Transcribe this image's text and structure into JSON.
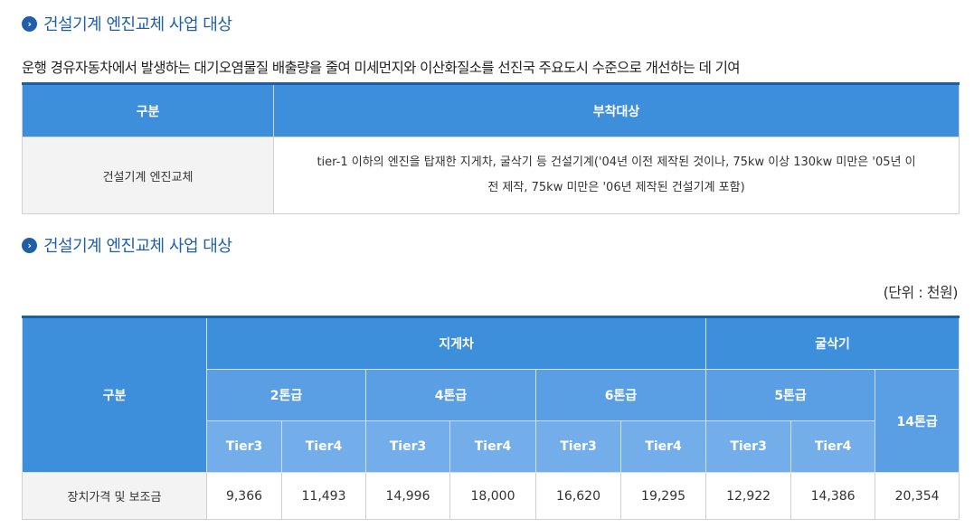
{
  "section1": {
    "heading": "건설기계 엔진교체 사업 대상",
    "description": "운행 경유자동차에서 발생하는 대기오염물질 배출량을 줄여 미세먼지와 이산화질소를 선진국 주요도시 수준으로 개선하는 데 기여",
    "table": {
      "col1_header": "구분",
      "col2_header": "부착대상",
      "row_label": "건설기계 엔진교체",
      "row_text_line1": "tier-1 이하의 엔진을 탑재한 지게차, 굴삭기 등 건설기계('04년 이전 제작된 것이나, 75kw 이상 130kw 미만은 '05년 이",
      "row_text_line2": "전 제작, 75kw 미만은 '06년 제작된 건설기계 포함)"
    }
  },
  "section2": {
    "heading": "건설기계 엔진교체 사업 대상",
    "unit": "(단위 : 천원)",
    "table": {
      "category_header": "구분",
      "group1": "지게차",
      "group2": "굴삭기",
      "sub": [
        "2톤급",
        "4톤급",
        "6톤급",
        "5톤급",
        "14톤급"
      ],
      "tiers": [
        "Tier3",
        "Tier4",
        "Tier3",
        "Tier4",
        "Tier3",
        "Tier4",
        "Tier3",
        "Tier4"
      ],
      "row_label": "장치가격 및 보조금",
      "values": [
        "9,366",
        "11,493",
        "14,996",
        "18,000",
        "16,620",
        "19,295",
        "12,922",
        "14,386",
        "20,354"
      ]
    }
  }
}
